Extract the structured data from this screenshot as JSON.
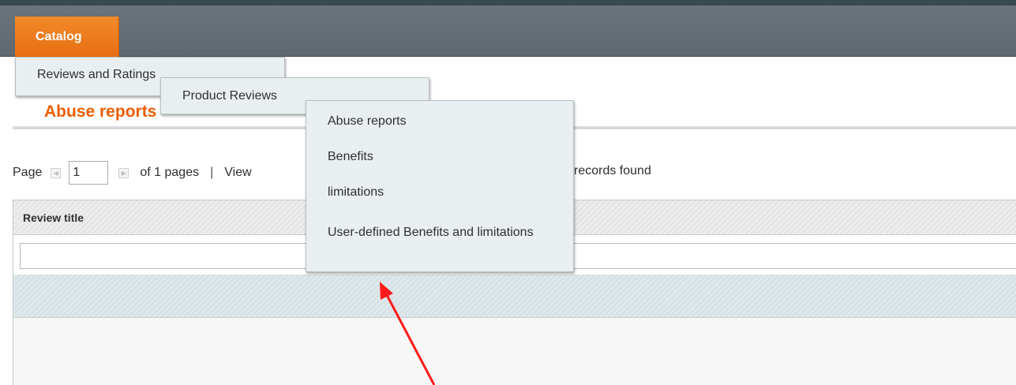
{
  "nav": {
    "catalog_label": "Catalog",
    "accent_color": "#eb5e00"
  },
  "menus": {
    "level1": "Reviews and Ratings",
    "level2": "Product Reviews",
    "level3": [
      "Abuse reports",
      "Benefits",
      "limitations",
      "User-defined Benefits and limitations"
    ]
  },
  "page": {
    "title": "Abuse reports"
  },
  "pager": {
    "page_label": "Page",
    "page_value": "1",
    "of_pages": "of 1 pages",
    "separator": "|",
    "view_label": "View",
    "records_text": "records found"
  },
  "grid": {
    "column_header": "Review title"
  }
}
